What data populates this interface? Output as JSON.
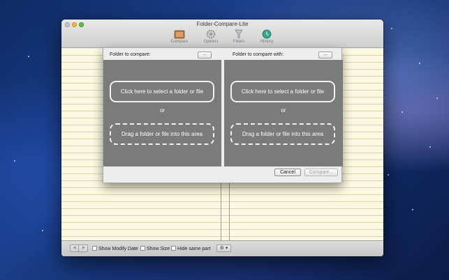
{
  "window": {
    "title": "Folder-Compare-Lite"
  },
  "toolbar": {
    "items": [
      {
        "label": "Compare",
        "icon": "compare-icon"
      },
      {
        "label": "Options",
        "icon": "gear-icon"
      },
      {
        "label": "Filters",
        "icon": "filter-icon"
      },
      {
        "label": "History",
        "icon": "history-icon"
      }
    ]
  },
  "sheet": {
    "left_label": "Folder to compare:",
    "right_label": "Folder to compare with:",
    "browse_label": "...",
    "select_label": "Click here to select a folder or file",
    "or_label": "or",
    "drag_label": "Drag a folder or file into this area",
    "cancel_label": "Cancel",
    "compare_label": "Compare..."
  },
  "bottombar": {
    "show_modify_date": "Show Modify Date",
    "show_size": "Show Size",
    "hide_same_part": "Hide same part",
    "action_menu": "⚙ ▾"
  },
  "colors": {
    "pane": "#7b7b7b",
    "paper": "#fbf9e1",
    "accent": "#ffffff"
  }
}
